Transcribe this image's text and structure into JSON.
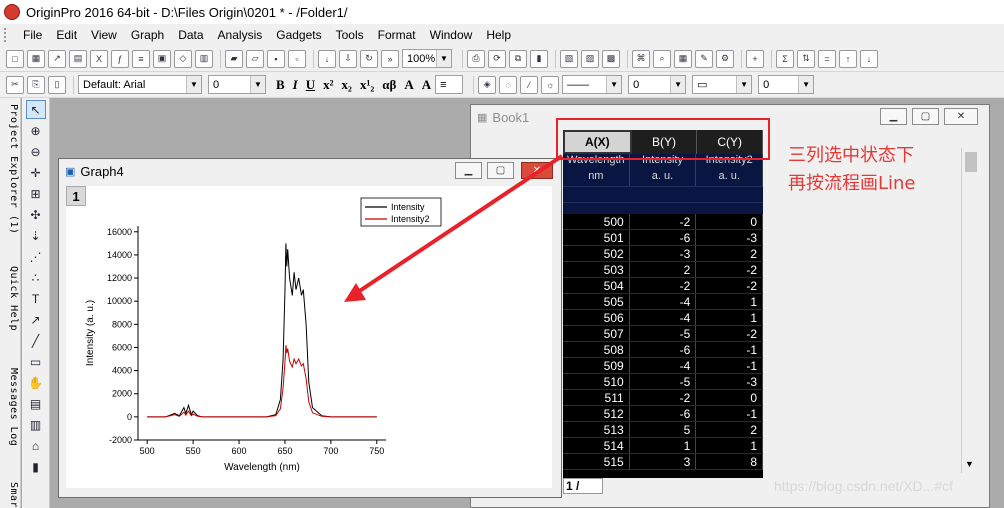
{
  "titlebar": {
    "title": "OriginPro 2016 64-bit - D:\\Files Origin\\0201 * - /Folder1/"
  },
  "menu": [
    "File",
    "Edit",
    "View",
    "Graph",
    "Data",
    "Analysis",
    "Gadgets",
    "Tools",
    "Format",
    "Window",
    "Help"
  ],
  "toolbar": {
    "zoom": "100%",
    "font": "Default: Arial",
    "fontsize": "0",
    "angle": "0",
    "linecombo1": "0",
    "linecombo2": "0"
  },
  "leftdock": {
    "project_explorer": "Project Explorer (1)",
    "quick_help": "Quick Help",
    "messages_log": "Messages Log",
    "smart": "Smar"
  },
  "book": {
    "title": "Book1",
    "sheet_tab": "1 /"
  },
  "graph": {
    "title": "Graph4",
    "layer": "1"
  },
  "sheet": {
    "columns": [
      "A(X)",
      "B(Y)",
      "C(Y)"
    ],
    "long_names": [
      "Wavelength",
      "Intensity",
      "Intensity2"
    ],
    "units": [
      "nm",
      "a. u.",
      "a. u."
    ],
    "rows": [
      [
        "500",
        "-2",
        "0"
      ],
      [
        "501",
        "-6",
        "-3"
      ],
      [
        "502",
        "-3",
        "2"
      ],
      [
        "503",
        "2",
        "-2"
      ],
      [
        "504",
        "-2",
        "-2"
      ],
      [
        "505",
        "-4",
        "1"
      ],
      [
        "506",
        "-4",
        "1"
      ],
      [
        "507",
        "-5",
        "-2"
      ],
      [
        "508",
        "-6",
        "-1"
      ],
      [
        "509",
        "-4",
        "-1"
      ],
      [
        "510",
        "-5",
        "-3"
      ],
      [
        "511",
        "-2",
        "0"
      ],
      [
        "512",
        "-6",
        "-1"
      ],
      [
        "513",
        "5",
        "2"
      ],
      [
        "514",
        "1",
        "1"
      ],
      [
        "515",
        "3",
        "8"
      ]
    ]
  },
  "annotation": {
    "line1": "三列选中状态下",
    "line2": "再按流程画Line"
  },
  "watermark": "https://blog.csdn.net/XD...#cf",
  "chart_data": {
    "type": "line",
    "xlabel": "Wavelength (nm)",
    "ylabel": "Intensity (a. u.)",
    "xlim": [
      490,
      760
    ],
    "ylim": [
      -2000,
      16500
    ],
    "xticks": [
      500,
      550,
      600,
      650,
      700,
      750
    ],
    "yticks": [
      -2000,
      0,
      2000,
      4000,
      6000,
      8000,
      10000,
      12000,
      14000,
      16000
    ],
    "legend": "top-right",
    "series": [
      {
        "name": "Intensity",
        "color": "#000000",
        "x": [
          500,
          520,
          530,
          535,
          540,
          542,
          545,
          548,
          550,
          555,
          560,
          570,
          600,
          630,
          640,
          645,
          648,
          650,
          651,
          652,
          653,
          655,
          658,
          660,
          662,
          665,
          668,
          670,
          673,
          676,
          680,
          690,
          700,
          720,
          750
        ],
        "y": [
          0,
          0,
          300,
          100,
          800,
          300,
          1000,
          200,
          500,
          100,
          0,
          0,
          0,
          0,
          200,
          1500,
          5000,
          11000,
          15000,
          13000,
          14500,
          12000,
          10500,
          12500,
          11000,
          12000,
          10500,
          11000,
          8000,
          3000,
          800,
          100,
          0,
          0,
          0
        ]
      },
      {
        "name": "Intensity2",
        "color": "#c80000",
        "x": [
          500,
          520,
          530,
          535,
          540,
          542,
          545,
          548,
          550,
          555,
          560,
          570,
          600,
          630,
          640,
          645,
          648,
          650,
          651,
          652,
          653,
          655,
          658,
          660,
          662,
          665,
          668,
          670,
          673,
          676,
          680,
          690,
          700,
          720,
          750
        ],
        "y": [
          0,
          0,
          200,
          50,
          400,
          150,
          500,
          100,
          250,
          50,
          0,
          0,
          0,
          0,
          100,
          700,
          2500,
          4800,
          6200,
          5500,
          5900,
          4800,
          4300,
          5000,
          4600,
          5000,
          4400,
          4600,
          3300,
          1300,
          350,
          50,
          0,
          0,
          0
        ]
      }
    ]
  }
}
